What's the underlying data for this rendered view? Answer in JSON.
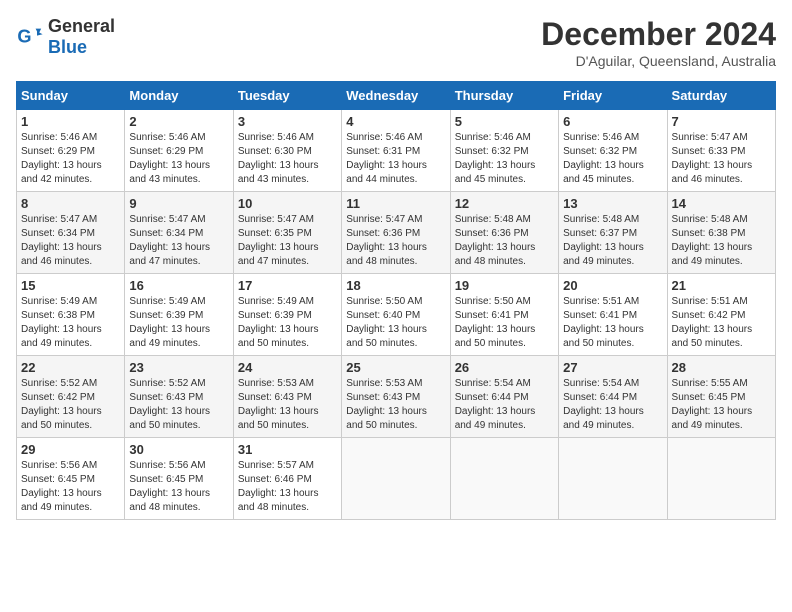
{
  "header": {
    "logo_general": "General",
    "logo_blue": "Blue",
    "month_title": "December 2024",
    "location": "D'Aguilar, Queensland, Australia"
  },
  "weekdays": [
    "Sunday",
    "Monday",
    "Tuesday",
    "Wednesday",
    "Thursday",
    "Friday",
    "Saturday"
  ],
  "weeks": [
    [
      {
        "day": "1",
        "sunrise": "5:46 AM",
        "sunset": "6:29 PM",
        "daylight": "13 hours and 42 minutes."
      },
      {
        "day": "2",
        "sunrise": "5:46 AM",
        "sunset": "6:29 PM",
        "daylight": "13 hours and 43 minutes."
      },
      {
        "day": "3",
        "sunrise": "5:46 AM",
        "sunset": "6:30 PM",
        "daylight": "13 hours and 43 minutes."
      },
      {
        "day": "4",
        "sunrise": "5:46 AM",
        "sunset": "6:31 PM",
        "daylight": "13 hours and 44 minutes."
      },
      {
        "day": "5",
        "sunrise": "5:46 AM",
        "sunset": "6:32 PM",
        "daylight": "13 hours and 45 minutes."
      },
      {
        "day": "6",
        "sunrise": "5:46 AM",
        "sunset": "6:32 PM",
        "daylight": "13 hours and 45 minutes."
      },
      {
        "day": "7",
        "sunrise": "5:47 AM",
        "sunset": "6:33 PM",
        "daylight": "13 hours and 46 minutes."
      }
    ],
    [
      {
        "day": "8",
        "sunrise": "5:47 AM",
        "sunset": "6:34 PM",
        "daylight": "13 hours and 46 minutes."
      },
      {
        "day": "9",
        "sunrise": "5:47 AM",
        "sunset": "6:34 PM",
        "daylight": "13 hours and 47 minutes."
      },
      {
        "day": "10",
        "sunrise": "5:47 AM",
        "sunset": "6:35 PM",
        "daylight": "13 hours and 47 minutes."
      },
      {
        "day": "11",
        "sunrise": "5:47 AM",
        "sunset": "6:36 PM",
        "daylight": "13 hours and 48 minutes."
      },
      {
        "day": "12",
        "sunrise": "5:48 AM",
        "sunset": "6:36 PM",
        "daylight": "13 hours and 48 minutes."
      },
      {
        "day": "13",
        "sunrise": "5:48 AM",
        "sunset": "6:37 PM",
        "daylight": "13 hours and 49 minutes."
      },
      {
        "day": "14",
        "sunrise": "5:48 AM",
        "sunset": "6:38 PM",
        "daylight": "13 hours and 49 minutes."
      }
    ],
    [
      {
        "day": "15",
        "sunrise": "5:49 AM",
        "sunset": "6:38 PM",
        "daylight": "13 hours and 49 minutes."
      },
      {
        "day": "16",
        "sunrise": "5:49 AM",
        "sunset": "6:39 PM",
        "daylight": "13 hours and 49 minutes."
      },
      {
        "day": "17",
        "sunrise": "5:49 AM",
        "sunset": "6:39 PM",
        "daylight": "13 hours and 50 minutes."
      },
      {
        "day": "18",
        "sunrise": "5:50 AM",
        "sunset": "6:40 PM",
        "daylight": "13 hours and 50 minutes."
      },
      {
        "day": "19",
        "sunrise": "5:50 AM",
        "sunset": "6:41 PM",
        "daylight": "13 hours and 50 minutes."
      },
      {
        "day": "20",
        "sunrise": "5:51 AM",
        "sunset": "6:41 PM",
        "daylight": "13 hours and 50 minutes."
      },
      {
        "day": "21",
        "sunrise": "5:51 AM",
        "sunset": "6:42 PM",
        "daylight": "13 hours and 50 minutes."
      }
    ],
    [
      {
        "day": "22",
        "sunrise": "5:52 AM",
        "sunset": "6:42 PM",
        "daylight": "13 hours and 50 minutes."
      },
      {
        "day": "23",
        "sunrise": "5:52 AM",
        "sunset": "6:43 PM",
        "daylight": "13 hours and 50 minutes."
      },
      {
        "day": "24",
        "sunrise": "5:53 AM",
        "sunset": "6:43 PM",
        "daylight": "13 hours and 50 minutes."
      },
      {
        "day": "25",
        "sunrise": "5:53 AM",
        "sunset": "6:43 PM",
        "daylight": "13 hours and 50 minutes."
      },
      {
        "day": "26",
        "sunrise": "5:54 AM",
        "sunset": "6:44 PM",
        "daylight": "13 hours and 49 minutes."
      },
      {
        "day": "27",
        "sunrise": "5:54 AM",
        "sunset": "6:44 PM",
        "daylight": "13 hours and 49 minutes."
      },
      {
        "day": "28",
        "sunrise": "5:55 AM",
        "sunset": "6:45 PM",
        "daylight": "13 hours and 49 minutes."
      }
    ],
    [
      {
        "day": "29",
        "sunrise": "5:56 AM",
        "sunset": "6:45 PM",
        "daylight": "13 hours and 49 minutes."
      },
      {
        "day": "30",
        "sunrise": "5:56 AM",
        "sunset": "6:45 PM",
        "daylight": "13 hours and 48 minutes."
      },
      {
        "day": "31",
        "sunrise": "5:57 AM",
        "sunset": "6:46 PM",
        "daylight": "13 hours and 48 minutes."
      },
      null,
      null,
      null,
      null
    ]
  ]
}
